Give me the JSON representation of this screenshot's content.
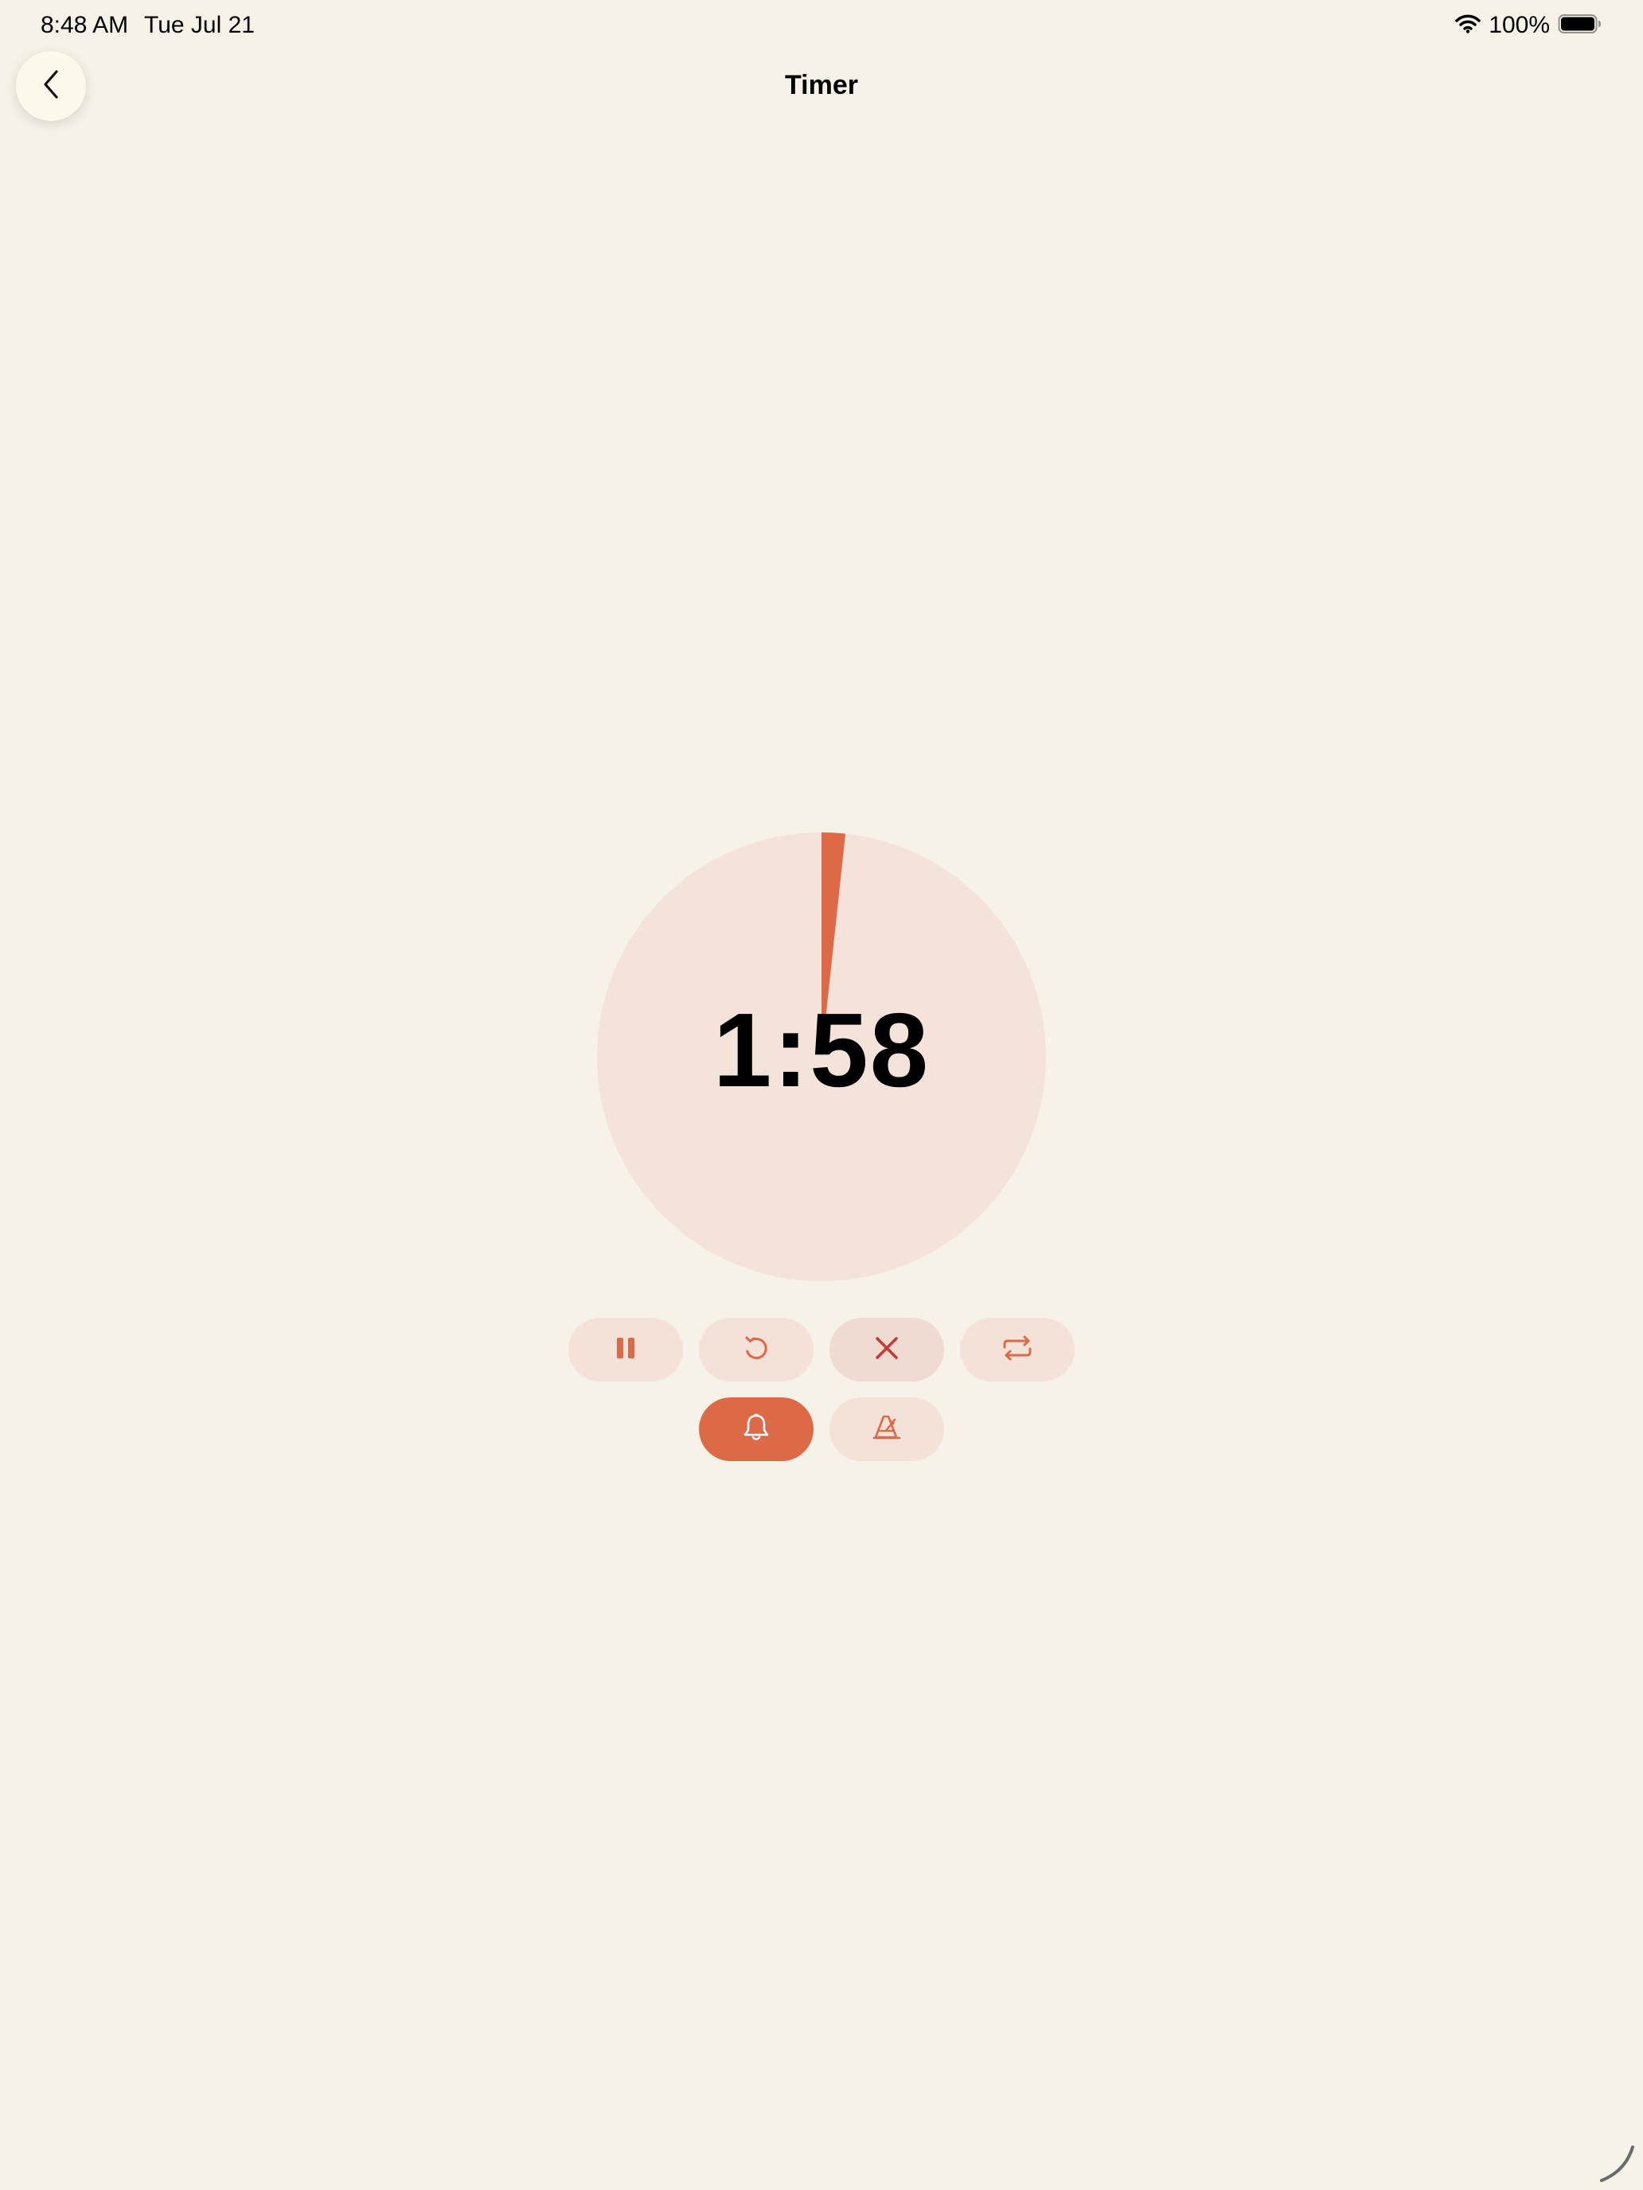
{
  "status_bar": {
    "time": "8:48 AM",
    "date": "Tue Jul 21",
    "battery_percent": "100%",
    "wifi_icon": "wifi-icon",
    "battery_icon": "battery-full-icon"
  },
  "nav": {
    "title": "Timer",
    "back_icon": "chevron-left-icon"
  },
  "timer": {
    "remaining": "1:58",
    "elapsed_fraction": 0.017,
    "colors": {
      "dial_background": "#F3E3DA",
      "progress": "#DD6A47"
    }
  },
  "controls": {
    "row1": [
      {
        "name": "pause",
        "icon": "pause-icon"
      },
      {
        "name": "restart",
        "icon": "restart-icon"
      },
      {
        "name": "cancel",
        "icon": "close-icon"
      },
      {
        "name": "repeat",
        "icon": "repeat-icon"
      }
    ],
    "row2": [
      {
        "name": "alarm",
        "icon": "bell-icon",
        "active": true
      },
      {
        "name": "metronome",
        "icon": "metronome-icon",
        "active": false
      }
    ]
  },
  "colors": {
    "background": "#F6F2E8",
    "accent": "#DD6A47",
    "button_bg": "#F4E2D9",
    "cancel_red": "#C83A35"
  }
}
